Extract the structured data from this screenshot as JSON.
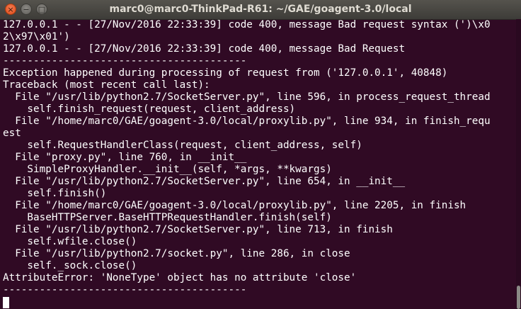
{
  "window": {
    "title": "marc0@marc0-ThinkPad-R61: ~/GAE/goagent-3.0/local",
    "close_symbol": "×",
    "minimize_symbol": "−",
    "maximize_symbol": "□"
  },
  "terminal": {
    "lines": [
      "127.0.0.1 - - [27/Nov/2016 22:33:39] code 400, message Bad request syntax (')\\x0",
      "2\\x97\\x01')",
      "127.0.0.1 - - [27/Nov/2016 22:33:39] code 400, message Bad Request",
      "----------------------------------------",
      "Exception happened during processing of request from ('127.0.0.1', 40848)",
      "Traceback (most recent call last):",
      "  File \"/usr/lib/python2.7/SocketServer.py\", line 596, in process_request_thread",
      "    self.finish_request(request, client_address)",
      "  File \"/home/marc0/GAE/goagent-3.0/local/proxylib.py\", line 934, in finish_requ",
      "est",
      "    self.RequestHandlerClass(request, client_address, self)",
      "  File \"proxy.py\", line 760, in __init__",
      "    SimpleProxyHandler.__init__(self, *args, **kwargs)",
      "  File \"/usr/lib/python2.7/SocketServer.py\", line 654, in __init__",
      "    self.finish()",
      "  File \"/home/marc0/GAE/goagent-3.0/local/proxylib.py\", line 2205, in finish",
      "    BaseHTTPServer.BaseHTTPRequestHandler.finish(self)",
      "  File \"/usr/lib/python2.7/SocketServer.py\", line 713, in finish",
      "    self.wfile.close()",
      "  File \"/usr/lib/python2.7/socket.py\", line 286, in close",
      "    self._sock.close()",
      "AttributeError: 'NoneType' object has no attribute 'close'",
      "----------------------------------------"
    ],
    "prompt": "",
    "scroll_position": 1.0,
    "scroll_visible_fraction": 0.08
  },
  "colors": {
    "background": "#300a24",
    "text": "#ffffff",
    "titlebar": "#45443f",
    "close_button": "#df4a16"
  }
}
